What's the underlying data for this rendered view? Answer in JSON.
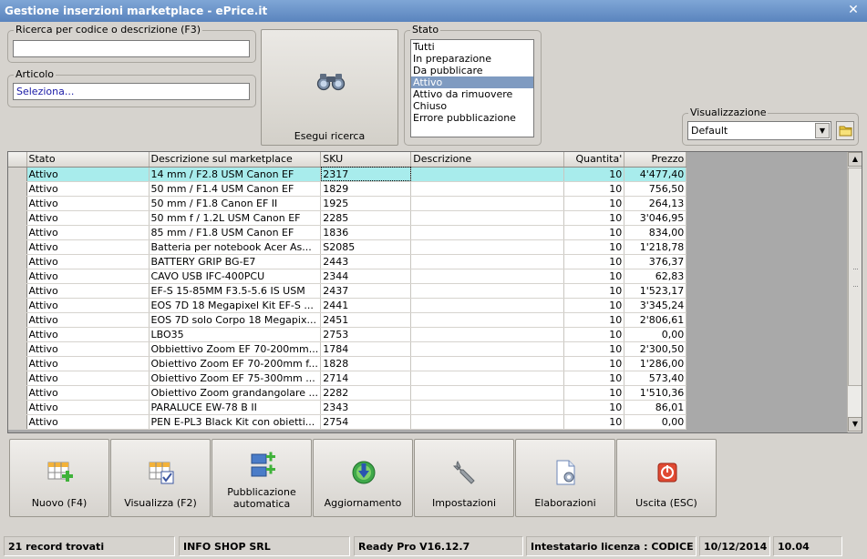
{
  "window": {
    "title": "Gestione inserzioni marketplace - ePrice.it",
    "close_label": "✕"
  },
  "search": {
    "group_label": "Ricerca per codice o descrizione (F3)",
    "value": ""
  },
  "articolo": {
    "group_label": "Articolo",
    "value": "Seleziona..."
  },
  "search_button": {
    "label": "Esegui ricerca",
    "icon": "binoculars-icon"
  },
  "stato": {
    "group_label": "Stato",
    "options": [
      "Tutti",
      "In preparazione",
      "Da pubblicare",
      "Attivo",
      "Attivo da rimuovere",
      "Chiuso",
      "Errore pubblicazione"
    ],
    "selected": "Attivo"
  },
  "visualizzazione": {
    "group_label": "Visualizzazione",
    "value": "Default",
    "folder_icon": "folder-icon"
  },
  "grid": {
    "columns": [
      "Stato",
      "Descrizione sul marketplace",
      "SKU",
      "Descrizione",
      "Quantita'",
      "Prezzo"
    ],
    "rows": [
      [
        "Attivo",
        "14 mm / F2.8 USM Canon EF",
        "2317",
        "",
        "10",
        "4'477,40"
      ],
      [
        "Attivo",
        "50 mm / F1.4 USM Canon EF",
        "1829",
        "",
        "10",
        "756,50"
      ],
      [
        "Attivo",
        "50 mm / F1.8 Canon EF II",
        "1925",
        "",
        "10",
        "264,13"
      ],
      [
        "Attivo",
        "50 mm f / 1.2L USM Canon EF",
        "2285",
        "",
        "10",
        "3'046,95"
      ],
      [
        "Attivo",
        "85 mm / F1.8 USM Canon EF",
        "1836",
        "",
        "10",
        "834,00"
      ],
      [
        "Attivo",
        "Batteria per notebook Acer As...",
        "S2085",
        "",
        "10",
        "1'218,78"
      ],
      [
        "Attivo",
        "BATTERY GRIP BG-E7",
        "2443",
        "",
        "10",
        "376,37"
      ],
      [
        "Attivo",
        "CAVO USB IFC-400PCU",
        "2344",
        "",
        "10",
        "62,83"
      ],
      [
        "Attivo",
        "EF-S 15-85MM F3.5-5.6 IS USM",
        "2437",
        "",
        "10",
        "1'523,17"
      ],
      [
        "Attivo",
        "EOS 7D 18 Megapixel Kit EF-S ...",
        "2441",
        "",
        "10",
        "3'345,24"
      ],
      [
        "Attivo",
        "EOS 7D solo Corpo 18 Megapix...",
        "2451",
        "",
        "10",
        "2'806,61"
      ],
      [
        "Attivo",
        "LBO35",
        "2753",
        "",
        "10",
        "0,00"
      ],
      [
        "Attivo",
        "Obbiettivo Zoom EF 70-200mm...",
        "1784",
        "",
        "10",
        "2'300,50"
      ],
      [
        "Attivo",
        "Obiettivo Zoom EF 70-200mm f...",
        "1828",
        "",
        "10",
        "1'286,00"
      ],
      [
        "Attivo",
        "Obiettivo Zoom EF 75-300mm ...",
        "2714",
        "",
        "10",
        "573,40"
      ],
      [
        "Attivo",
        "Obiettivo Zoom grandangolare ...",
        "2282",
        "",
        "10",
        "1'510,36"
      ],
      [
        "Attivo",
        "PARALUCE EW-78 B II",
        "2343",
        "",
        "10",
        "86,01"
      ],
      [
        "Attivo",
        "PEN E-PL3 Black Kit con obietti...",
        "2754",
        "",
        "10",
        "0,00"
      ]
    ]
  },
  "toolbar": [
    {
      "label": "Nuovo (F4)",
      "icon": "new-grid-icon"
    },
    {
      "label": "Visualizza (F2)",
      "icon": "view-grid-icon"
    },
    {
      "label": "Pubblicazione automatica",
      "icon": "auto-publish-icon"
    },
    {
      "label": "Aggiornamento",
      "icon": "update-icon"
    },
    {
      "label": "Impostazioni",
      "icon": "wrench-icon"
    },
    {
      "label": "Elaborazioni",
      "icon": "process-document-icon"
    },
    {
      "label": "Uscita (ESC)",
      "icon": "power-icon"
    }
  ],
  "status": {
    "records": "21 record trovati",
    "company": "INFO SHOP SRL",
    "version": "Ready Pro V16.12.7",
    "license": "Intestatario licenza : CODICE SRL",
    "date": "10/12/2014",
    "time": "10.04"
  },
  "colors": {
    "selected_row": "#a8ecec",
    "list_selected": "#7f9bc1",
    "title_bar": "#5a84be"
  }
}
